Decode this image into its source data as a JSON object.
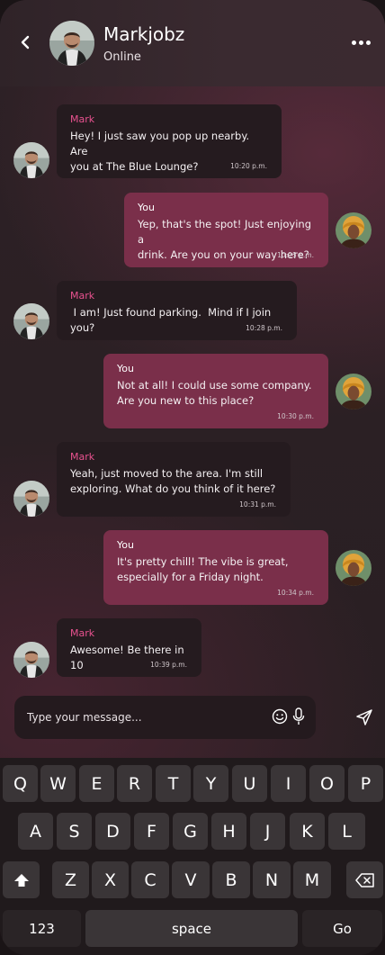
{
  "header": {
    "name": "Markjobz",
    "status": "Online"
  },
  "messages": [
    {
      "sender": "Mark",
      "text": "Hey! I just saw you pop up nearby. Are\nyou at The Blue Lounge?",
      "time": "10:20 p.m."
    },
    {
      "sender": "You",
      "text": "Yep, that's the spot! Just enjoying a\ndrink. Are you on your way here?",
      "time": "10:25 p.m."
    },
    {
      "sender": "Mark",
      "text": " I am! Just found parking.  Mind if I join you?",
      "time": "10:28 p.m."
    },
    {
      "sender": "You",
      "text": "Not at all! I could use some company.\nAre you new to this place?",
      "time": "10:30 p.m."
    },
    {
      "sender": "Mark",
      "text": "Yeah, just moved to the area. I'm still\nexploring. What do you think of it here?",
      "time": "10:31 p.m."
    },
    {
      "sender": "You",
      "text": "It's pretty chill! The vibe is great,\nespecially for a Friday night.",
      "time": "10:34 p.m."
    },
    {
      "sender": "Mark",
      "text": "Awesome! Be there in 10",
      "time": "10:39 p.m."
    }
  ],
  "composer": {
    "placeholder": "Type your message..."
  },
  "keyboard": {
    "row1": [
      "Q",
      "W",
      "E",
      "R",
      "T",
      "Y",
      "U",
      "I",
      "O",
      "P"
    ],
    "row2": [
      "A",
      "S",
      "D",
      "F",
      "G",
      "H",
      "J",
      "K",
      "L"
    ],
    "row3": [
      "Z",
      "X",
      "C",
      "V",
      "B",
      "N",
      "M"
    ],
    "numbers_label": "123",
    "space_label": "space",
    "go_label": "Go"
  },
  "icons": {
    "back": "chevron-left-icon",
    "more": "more-horizontal-icon",
    "emoji": "smile-icon",
    "mic": "mic-icon",
    "send": "send-icon",
    "shift": "shift-icon",
    "backspace": "backspace-icon"
  },
  "colors": {
    "incoming_bubble": "#251b1f",
    "outgoing_bubble": "#7a2f4a",
    "sender_accent": "#e8528f"
  }
}
